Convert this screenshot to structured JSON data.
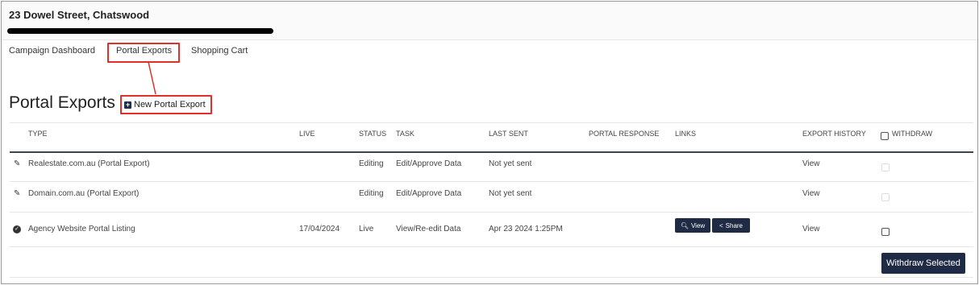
{
  "header": {
    "address": "23 Dowel Street, Chatswood"
  },
  "nav": {
    "items": [
      "Campaign Dashboard",
      "Portal Exports",
      "Shopping Cart"
    ]
  },
  "page": {
    "title": "Portal Exports",
    "new_button_label": "New Portal Export"
  },
  "table": {
    "headers": [
      "TYPE",
      "LIVE",
      "STATUS",
      "TASK",
      "LAST SENT",
      "PORTAL RESPONSE",
      "LINKS",
      "EXPORT HISTORY",
      "WITHDRAW"
    ],
    "rows": [
      {
        "icon": "pencil-icon",
        "type": "Realestate.com.au (Portal Export)",
        "live": "",
        "status": "Editing",
        "task": "Edit/Approve Data",
        "last_sent": "Not yet sent",
        "portal_response": "",
        "export_history": "View",
        "withdraw_enabled": false
      },
      {
        "icon": "pencil-icon",
        "type": "Domain.com.au (Portal Export)",
        "live": "",
        "status": "Editing",
        "task": "Edit/Approve Data",
        "last_sent": "Not yet sent",
        "portal_response": "",
        "export_history": "View",
        "withdraw_enabled": false
      },
      {
        "icon": "check-circle-icon",
        "type": "Agency Website Portal Listing",
        "live": "17/04/2024",
        "status": "Live",
        "task": "View/Re-edit Data",
        "last_sent": "Apr 23 2024 1:25PM",
        "portal_response": "",
        "links": {
          "view_label": "View",
          "share_label": "Share"
        },
        "export_history": "View",
        "withdraw_enabled": true
      }
    ]
  },
  "footer": {
    "withdraw_selected_label": "Withdraw Selected"
  },
  "colors": {
    "highlight": "#e0302a",
    "button_dark": "#1f2a44"
  }
}
